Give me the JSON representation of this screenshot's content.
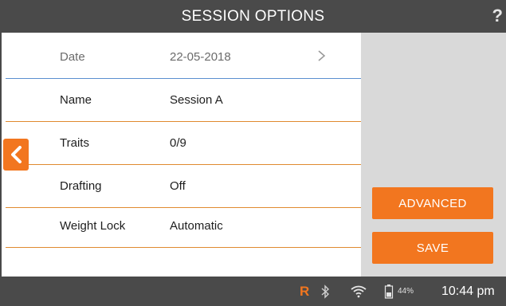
{
  "header": {
    "title": "SESSION OPTIONS",
    "help_label": "?"
  },
  "fields": [
    {
      "label": "Date",
      "value": "22-05-2018"
    },
    {
      "label": "Name",
      "value": "Session A"
    },
    {
      "label": "Traits",
      "value": "0/9"
    },
    {
      "label": "Drafting",
      "value": "Off"
    },
    {
      "label": "Weight Lock",
      "value": "Automatic"
    }
  ],
  "actions": {
    "advanced_label": "ADVANCED",
    "save_label": "SAVE"
  },
  "status_bar": {
    "r_label": "R",
    "battery_percent": "44%",
    "time": "10:44 pm"
  },
  "colors": {
    "accent": "#f2761f",
    "bar": "#4a4a4a",
    "side_panel": "#d9d9d9",
    "date_divider": "#5b8fd0",
    "row_divider": "#e08a2f"
  },
  "icons": {
    "back": "chevron-left-icon",
    "date_chevron": "chevron-right-icon",
    "bluetooth": "bluetooth-icon",
    "wifi": "wifi-icon",
    "battery": "battery-icon"
  }
}
